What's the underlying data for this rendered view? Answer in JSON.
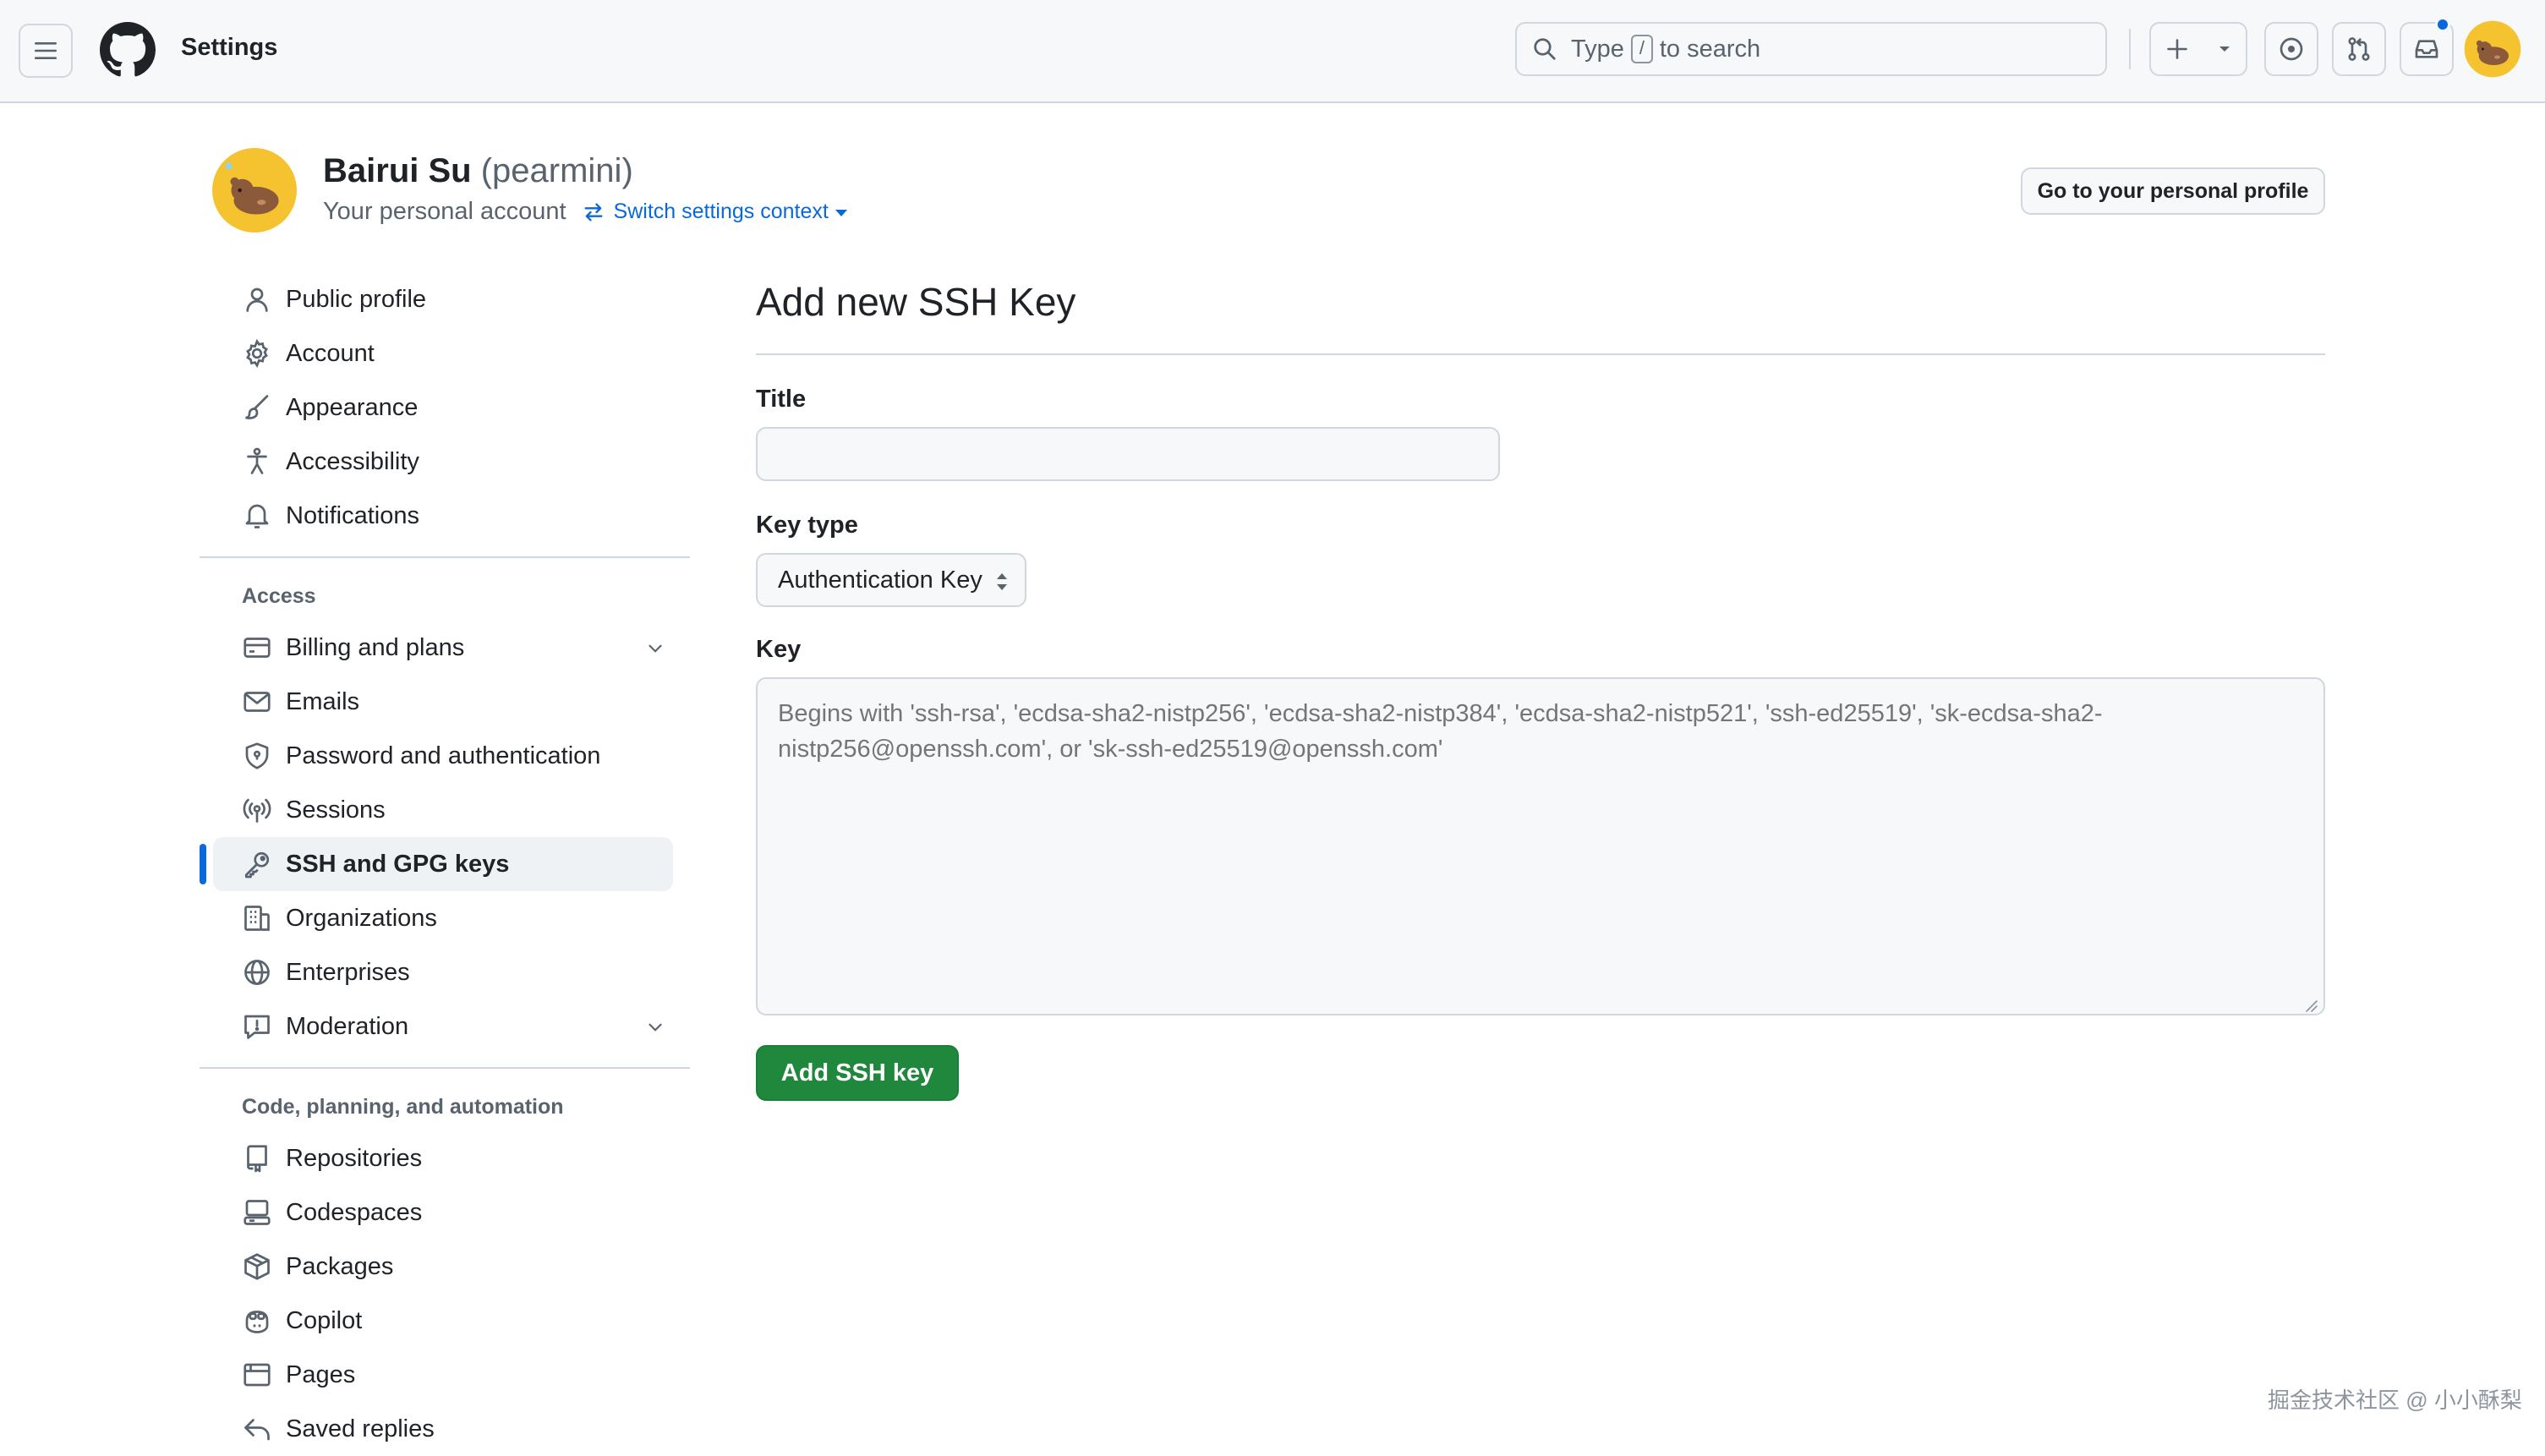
{
  "header": {
    "title": "Settings",
    "search_prefix": "Type",
    "search_key": "/",
    "search_suffix": "to search"
  },
  "profile": {
    "name": "Bairui Su",
    "login": "(pearmini)",
    "subtitle": "Your personal account",
    "switch_label": "Switch settings context",
    "profile_button": "Go to your personal profile"
  },
  "sidebar": {
    "top": [
      {
        "label": "Public profile"
      },
      {
        "label": "Account"
      },
      {
        "label": "Appearance"
      },
      {
        "label": "Accessibility"
      },
      {
        "label": "Notifications"
      }
    ],
    "access_heading": "Access",
    "access": [
      {
        "label": "Billing and plans"
      },
      {
        "label": "Emails"
      },
      {
        "label": "Password and authentication"
      },
      {
        "label": "Sessions"
      },
      {
        "label": "SSH and GPG keys"
      },
      {
        "label": "Organizations"
      },
      {
        "label": "Enterprises"
      },
      {
        "label": "Moderation"
      }
    ],
    "code_heading": "Code, planning, and automation",
    "code": [
      {
        "label": "Repositories"
      },
      {
        "label": "Codespaces"
      },
      {
        "label": "Packages"
      },
      {
        "label": "Copilot"
      },
      {
        "label": "Pages"
      },
      {
        "label": "Saved replies"
      }
    ]
  },
  "form": {
    "heading": "Add new SSH Key",
    "title_label": "Title",
    "title_value": "",
    "key_type_label": "Key type",
    "key_type_value": "Authentication Key",
    "key_label": "Key",
    "key_placeholder": "Begins with 'ssh-rsa', 'ecdsa-sha2-nistp256', 'ecdsa-sha2-nistp384', 'ecdsa-sha2-nistp521', 'ssh-ed25519', 'sk-ecdsa-sha2-nistp256@openssh.com', or 'sk-ssh-ed25519@openssh.com'",
    "submit_label": "Add SSH key"
  },
  "watermark": "掘金技术社区 @ 小小酥梨",
  "colors": {
    "accent": "#0969da",
    "primary_button": "#1f883d",
    "header_bg": "#f6f8fa",
    "border": "#d0d7de",
    "avatar": "#f5c330"
  }
}
